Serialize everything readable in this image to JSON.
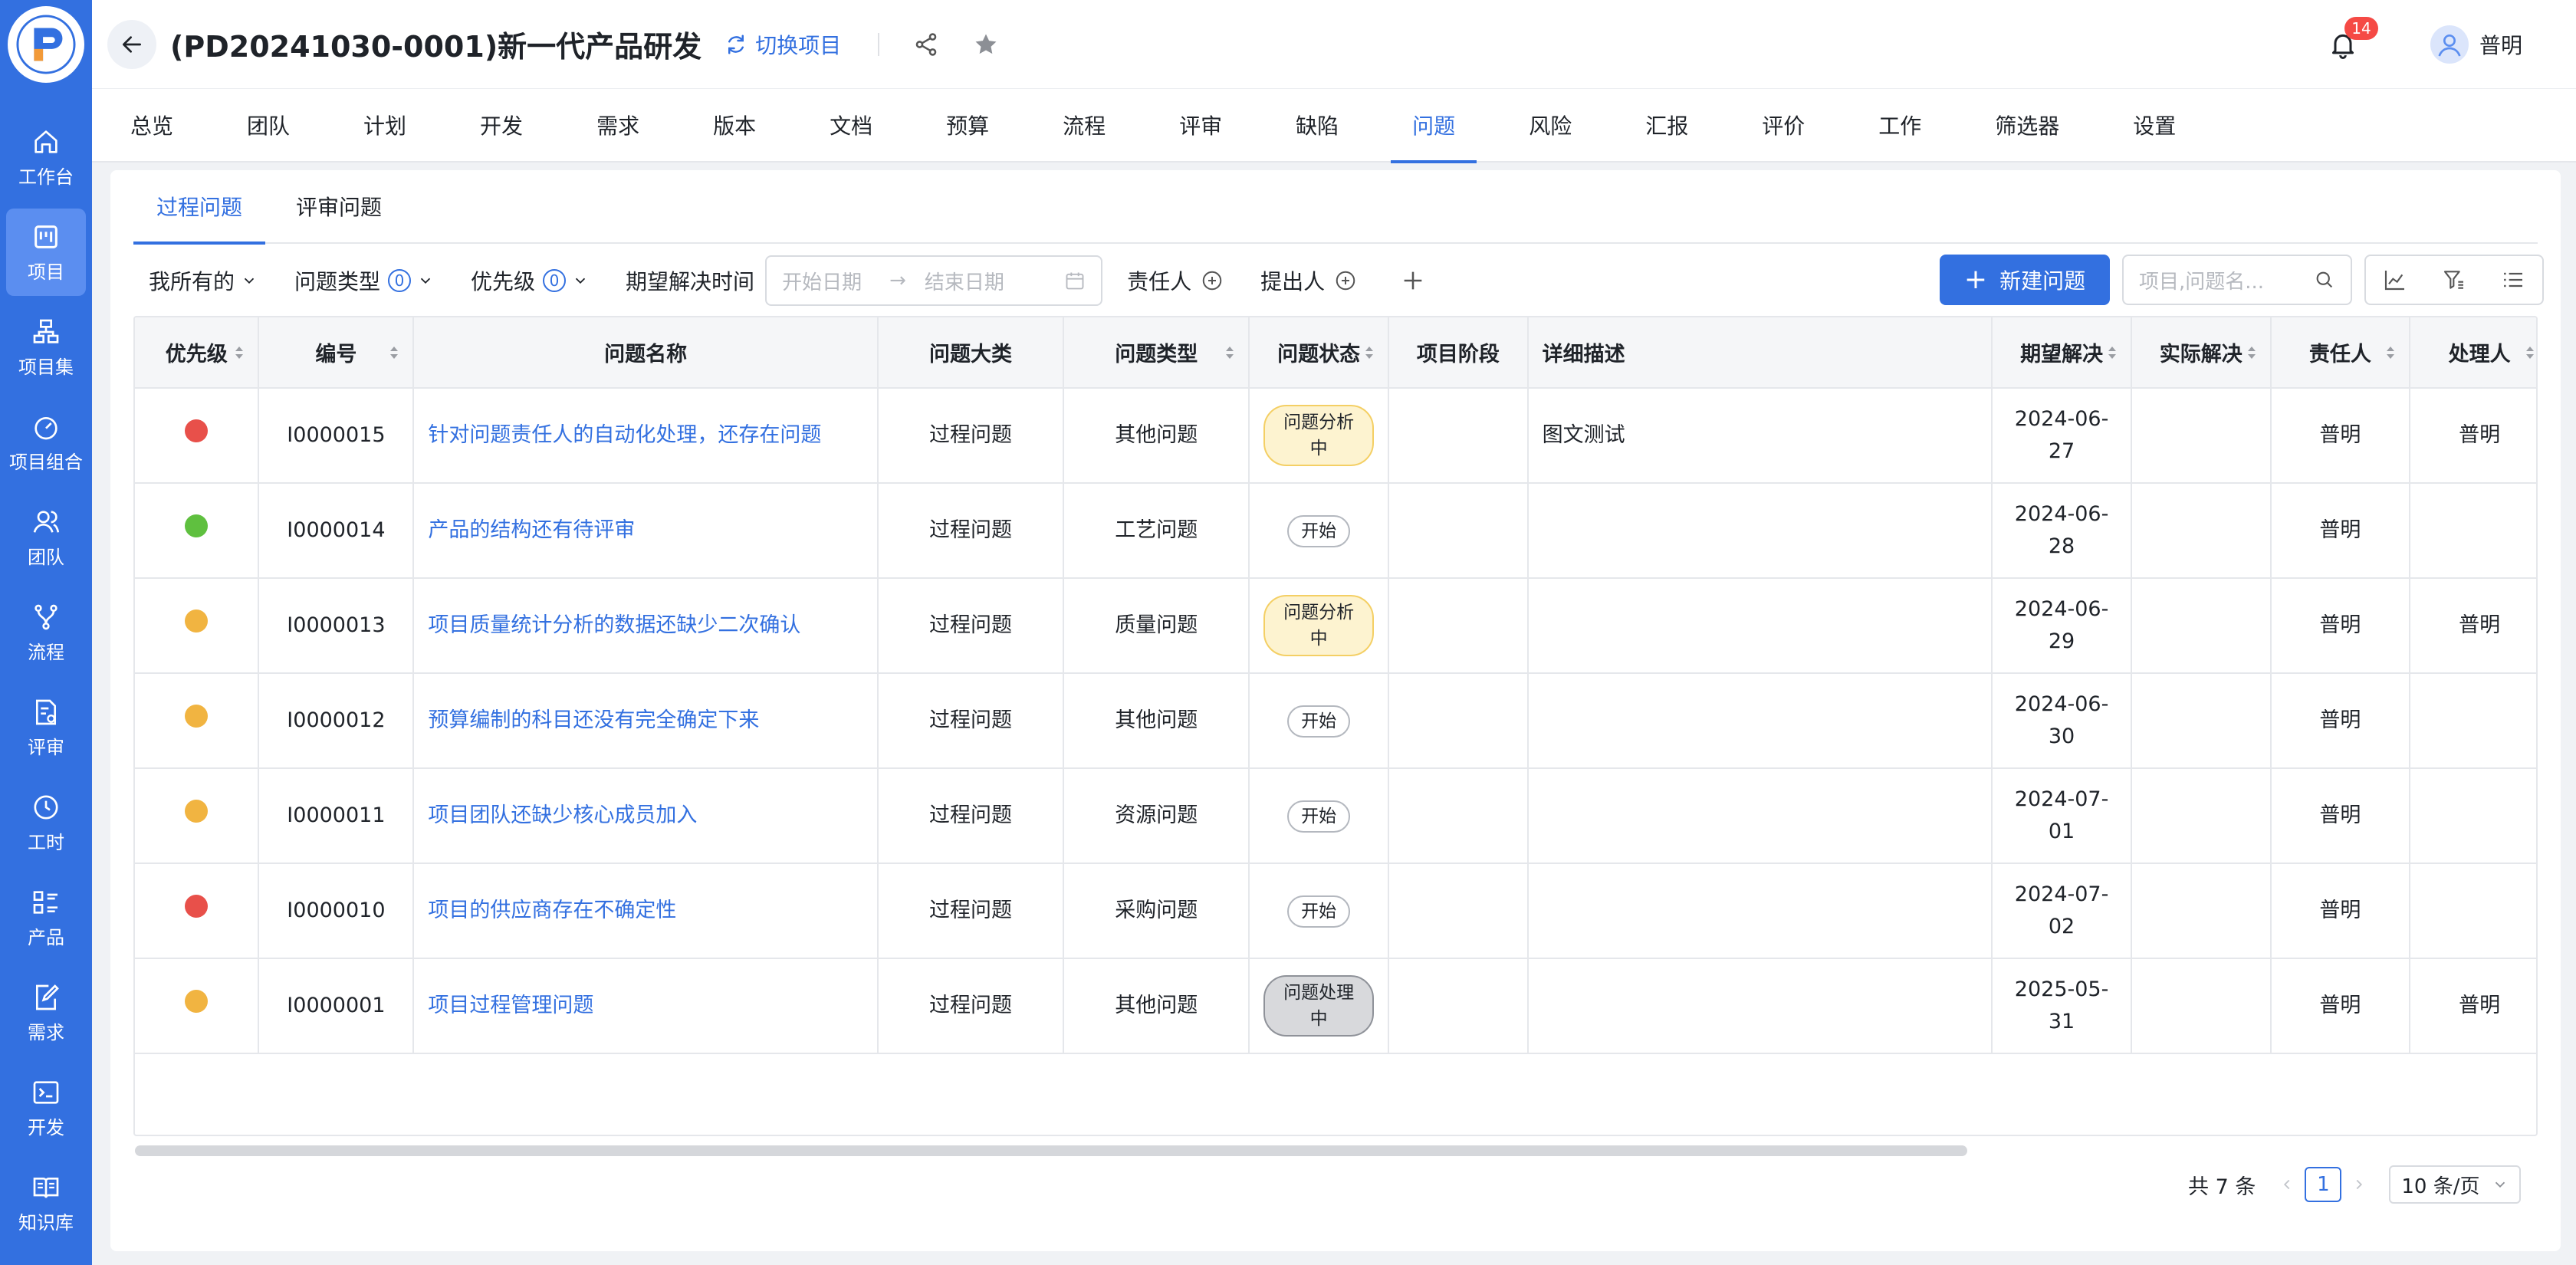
{
  "colors": {
    "brand": "#3370e0",
    "priority_high": "#e8504a",
    "priority_medium": "#f1b441",
    "priority_low": "#5fc03f"
  },
  "sidebar": {
    "items": [
      {
        "label": "工作台",
        "icon": "home-icon"
      },
      {
        "label": "项目",
        "icon": "kanban-icon",
        "active": true
      },
      {
        "label": "项目集",
        "icon": "hierarchy-icon"
      },
      {
        "label": "项目组合",
        "icon": "dashboard-gauge-icon"
      },
      {
        "label": "团队",
        "icon": "team-icon"
      },
      {
        "label": "流程",
        "icon": "branch-icon"
      },
      {
        "label": "评审",
        "icon": "review-icon"
      },
      {
        "label": "工时",
        "icon": "clock-icon"
      },
      {
        "label": "产品",
        "icon": "grid-list-icon"
      },
      {
        "label": "需求",
        "icon": "edit-doc-icon"
      },
      {
        "label": "开发",
        "icon": "terminal-icon"
      },
      {
        "label": "知识库",
        "icon": "book-icon"
      }
    ]
  },
  "header": {
    "title": "(PD20241030-0001)新一代产品研发",
    "switch_label": "切换项目",
    "notification_count": "14",
    "user_name": "普明"
  },
  "top_tabs": [
    "总览",
    "团队",
    "计划",
    "开发",
    "需求",
    "版本",
    "文档",
    "预算",
    "流程",
    "评审",
    "缺陷",
    "问题",
    "风险",
    "汇报",
    "评价",
    "工作",
    "筛选器",
    "设置"
  ],
  "active_top_tab": "问题",
  "sub_tabs": [
    "过程问题",
    "评审问题"
  ],
  "filters": {
    "mine": "我所有的",
    "issue_type": "问题类型",
    "issue_type_count": "0",
    "priority": "优先级",
    "priority_count": "0",
    "expected_time": "期望解决时间",
    "start_placeholder": "开始日期",
    "end_placeholder": "结束日期",
    "owner": "责任人",
    "reporter": "提出人",
    "new_button": "新建问题",
    "search_placeholder": "项目,问题名..."
  },
  "table": {
    "columns": [
      "优先级",
      "编号",
      "问题名称",
      "问题大类",
      "问题类型",
      "问题状态",
      "项目阶段",
      "详细描述",
      "期望解决",
      "实际解决",
      "责任人",
      "处理人"
    ],
    "rows": [
      {
        "priority": "high",
        "id": "I0000015",
        "name": "针对问题责任人的自动化处理，还存在问题",
        "category": "过程问题",
        "type": "其他问题",
        "status": "问题分析中",
        "status_style": "yellow",
        "stage": "",
        "desc": "图文测试",
        "expected": "2024-06-27",
        "actual": "",
        "owner": "普明",
        "handler": "普明"
      },
      {
        "priority": "low",
        "id": "I0000014",
        "name": "产品的结构还有待评审",
        "category": "过程问题",
        "type": "工艺问题",
        "status": "开始",
        "status_style": "white",
        "stage": "",
        "desc": "",
        "expected": "2024-06-28",
        "actual": "",
        "owner": "普明",
        "handler": ""
      },
      {
        "priority": "medium",
        "id": "I0000013",
        "name": "项目质量统计分析的数据还缺少二次确认",
        "category": "过程问题",
        "type": "质量问题",
        "status": "问题分析中",
        "status_style": "yellow",
        "stage": "",
        "desc": "",
        "expected": "2024-06-29",
        "actual": "",
        "owner": "普明",
        "handler": "普明"
      },
      {
        "priority": "medium",
        "id": "I0000012",
        "name": "预算编制的科目还没有完全确定下来",
        "category": "过程问题",
        "type": "其他问题",
        "status": "开始",
        "status_style": "white",
        "stage": "",
        "desc": "",
        "expected": "2024-06-30",
        "actual": "",
        "owner": "普明",
        "handler": ""
      },
      {
        "priority": "medium",
        "id": "I0000011",
        "name": "项目团队还缺少核心成员加入",
        "category": "过程问题",
        "type": "资源问题",
        "status": "开始",
        "status_style": "white",
        "stage": "",
        "desc": "",
        "expected": "2024-07-01",
        "actual": "",
        "owner": "普明",
        "handler": ""
      },
      {
        "priority": "high",
        "id": "I0000010",
        "name": "项目的供应商存在不确定性",
        "category": "过程问题",
        "type": "采购问题",
        "status": "开始",
        "status_style": "white",
        "stage": "",
        "desc": "",
        "expected": "2024-07-02",
        "actual": "",
        "owner": "普明",
        "handler": ""
      },
      {
        "priority": "medium",
        "id": "I0000001",
        "name": "项目过程管理问题",
        "category": "过程问题",
        "type": "其他问题",
        "status": "问题处理中",
        "status_style": "gray",
        "stage": "",
        "desc": "",
        "expected": "2025-05-31",
        "actual": "",
        "owner": "普明",
        "handler": "普明"
      }
    ]
  },
  "pagination": {
    "total_text": "共 7 条",
    "current_page": "1",
    "page_size": "10 条/页"
  }
}
